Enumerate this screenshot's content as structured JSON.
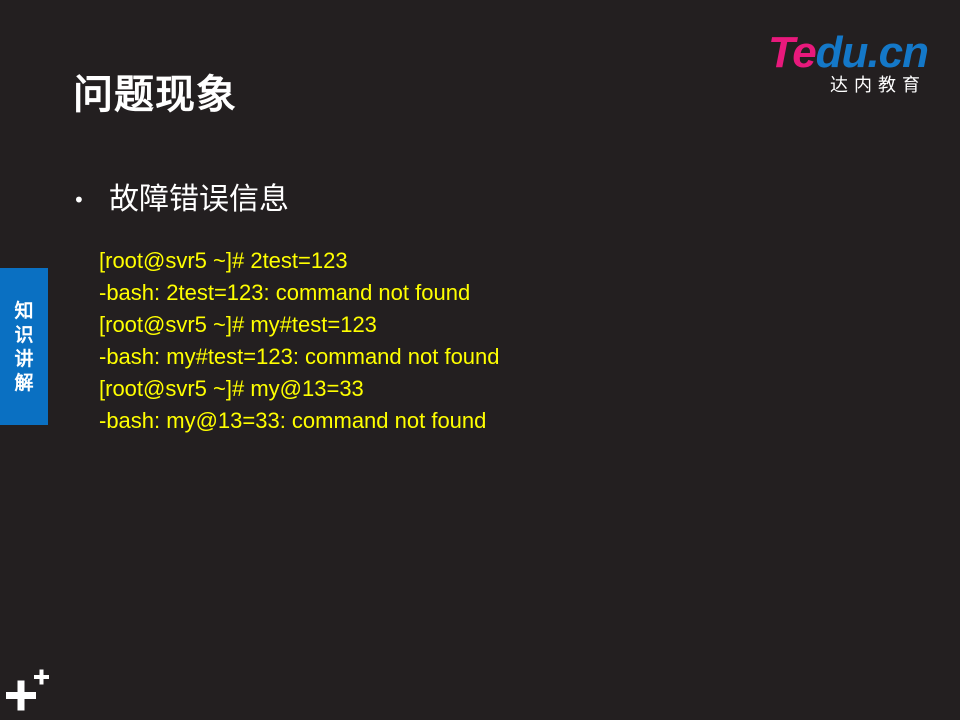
{
  "slide": {
    "title": "问题现象",
    "bullet_marker": "•",
    "bullet_text": "故障错误信息"
  },
  "logo": {
    "wordmark_te": "Te",
    "wordmark_rest": "du.cn",
    "subtitle": "达内教育",
    "colors": {
      "pink": "#e8197c",
      "blue": "#1478c8"
    }
  },
  "terminal": {
    "lines": [
      "[root@svr5 ~]# 2test=123",
      "-bash: 2test=123: command not found",
      "[root@svr5 ~]# my#test=123",
      "-bash: my#test=123: command not found",
      "[root@svr5 ~]# my@13=33",
      "-bash: my@13=33: command not found"
    ],
    "text_color": "#ffff00"
  },
  "side_tab": {
    "label": "知识讲解",
    "color": "#0a70c2"
  },
  "corner_icon": "plus-plus-icon",
  "background_color": "#231f20"
}
